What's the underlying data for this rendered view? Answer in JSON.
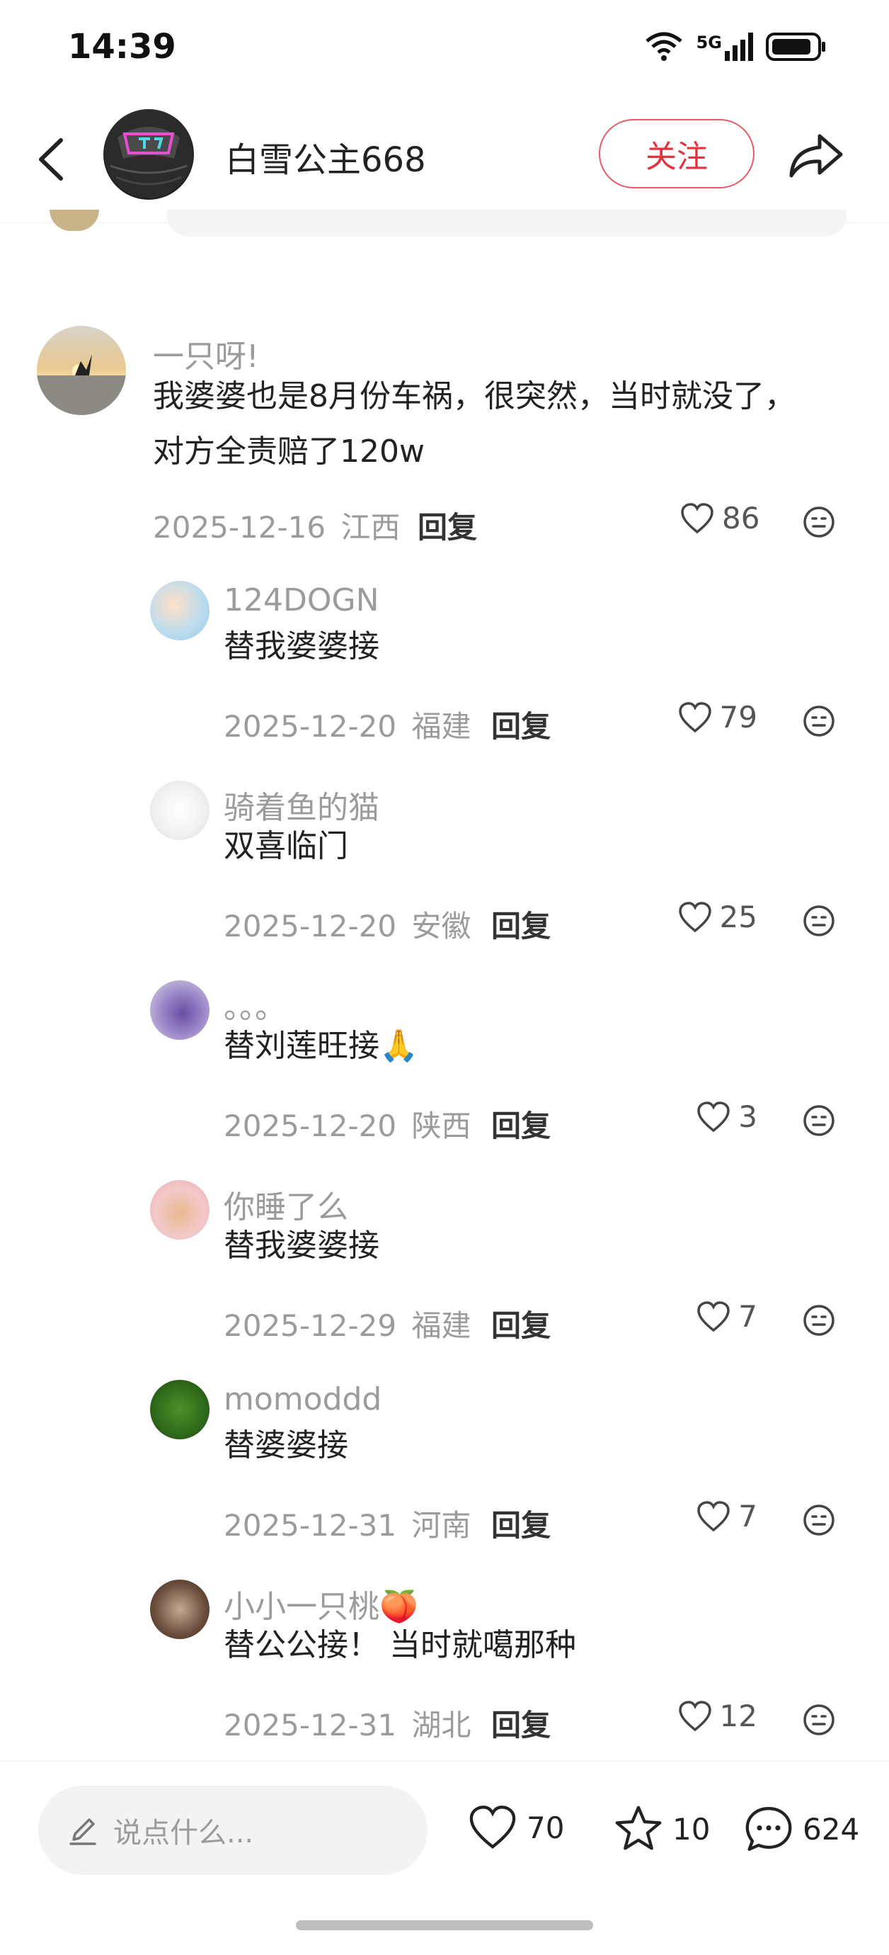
{
  "status_bar": {
    "time": "14:39",
    "network": "5G"
  },
  "header": {
    "username": "白雪公主668",
    "follow_label": "关注"
  },
  "main_comment": {
    "author": "一只呀!",
    "text": "我婆婆也是8月份车祸，很突然，当时就没了，对方全责赔了120w",
    "date": "2025-12-16",
    "location": "江西",
    "reply_label": "回复",
    "likes": "86"
  },
  "replies": [
    {
      "author": "124DOGN",
      "text": "替我婆婆接",
      "date": "2025-12-20",
      "location": "福建",
      "reply_label": "回复",
      "likes": "79"
    },
    {
      "author": "骑着鱼的猫",
      "text": "双喜临门",
      "date": "2025-12-20",
      "location": "安徽",
      "reply_label": "回复",
      "likes": "25"
    },
    {
      "author": "。。。",
      "text": "替刘莲旺接🙏",
      "date": "2025-12-20",
      "location": "陕西",
      "reply_label": "回复",
      "likes": "3"
    },
    {
      "author": "你睡了么",
      "text": "替我婆婆接",
      "date": "2025-12-29",
      "location": "福建",
      "reply_label": "回复",
      "likes": "7"
    },
    {
      "author": "momoddd",
      "text": "替婆婆接",
      "date": "2025-12-31",
      "location": "河南",
      "reply_label": "回复",
      "likes": "7"
    },
    {
      "author": "小小一只桃🍑",
      "text": "替公公接！ 当时就噶那种",
      "date": "2025-12-31",
      "location": "湖北",
      "reply_label": "回复",
      "likes": "12"
    }
  ],
  "bottom_bar": {
    "input_placeholder": "说点什么...",
    "likes": "70",
    "favorites": "10",
    "comments": "624"
  },
  "colors": {
    "accent": "#e0353f",
    "meta": "#9b9b9b",
    "text": "#222222"
  }
}
